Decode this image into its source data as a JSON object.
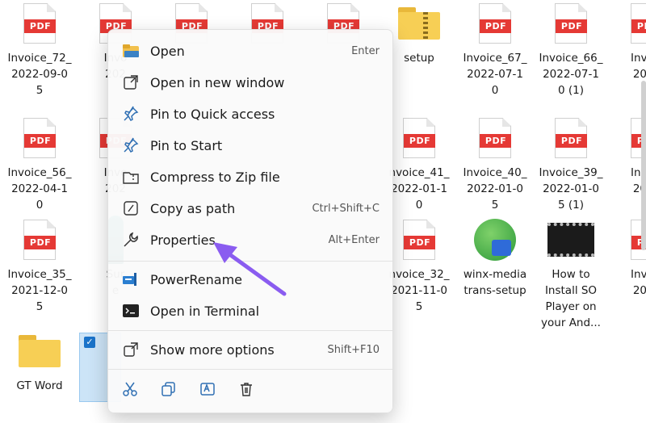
{
  "files": [
    {
      "name": "Invoice_72_\n2022-09-0\n5",
      "type": "pdf"
    },
    {
      "name": "Invo\n202",
      "type": "pdf"
    },
    {
      "name": "",
      "type": "pdf"
    },
    {
      "name": "",
      "type": "pdf"
    },
    {
      "name": "",
      "type": "pdf"
    },
    {
      "name": "setup",
      "type": "zip"
    },
    {
      "name": "Invoice_67_\n2022-07-1\n0",
      "type": "pdf"
    },
    {
      "name": "Invoice_66_\n2022-07-1\n0 (1)",
      "type": "pdf"
    },
    {
      "name": "Invoic\n2022",
      "type": "pdf"
    },
    {
      "name": "Invoice_56_\n2022-04-1\n0",
      "type": "pdf"
    },
    {
      "name": "Invo\n202",
      "type": "pdf"
    },
    {
      "name": "nvoice_41_\n2022-01-1\n0",
      "type": "pdf"
    },
    {
      "name": "Invoice_40_\n2022-01-0\n5",
      "type": "pdf"
    },
    {
      "name": "Invoice_39_\n2022-01-0\n5 (1)",
      "type": "pdf"
    },
    {
      "name": "Invoic\n2022",
      "type": "pdf"
    },
    {
      "name": "Invoice_35_\n2021-12-0\n5",
      "type": "pdf"
    },
    {
      "name": "Sur\ne",
      "type": "app-teal"
    },
    {
      "name": "nvoice_32_\n2021-11-0\n5",
      "type": "pdf"
    },
    {
      "name": "winx-media\ntrans-setup",
      "type": "app"
    },
    {
      "name": "How to\nInstall SO\nPlayer on\nyour And...",
      "type": "video"
    },
    {
      "name": "Invoic\n2021",
      "type": "pdf"
    },
    {
      "name": "GT Word",
      "type": "folder"
    }
  ],
  "pdf_badge": "PDF",
  "menu": {
    "items": [
      {
        "label": "Open",
        "shortcut": "Enter",
        "icon": "folder-open-icon"
      },
      {
        "label": "Open in new window",
        "shortcut": "",
        "icon": "open-new-window-icon"
      },
      {
        "label": "Pin to Quick access",
        "shortcut": "",
        "icon": "pin-icon"
      },
      {
        "label": "Pin to Start",
        "shortcut": "",
        "icon": "pin-icon"
      },
      {
        "label": "Compress to Zip file",
        "shortcut": "",
        "icon": "zip-icon"
      },
      {
        "label": "Copy as path",
        "shortcut": "Ctrl+Shift+C",
        "icon": "copy-path-icon"
      },
      {
        "label": "Properties",
        "shortcut": "Alt+Enter",
        "icon": "wrench-icon"
      },
      {
        "label": "PowerRename",
        "shortcut": "",
        "icon": "power-rename-icon"
      },
      {
        "label": "Open in Terminal",
        "shortcut": "",
        "icon": "terminal-icon"
      },
      {
        "label": "Show more options",
        "shortcut": "Shift+F10",
        "icon": "show-more-icon"
      }
    ],
    "tools": [
      "cut-icon",
      "copy-icon",
      "rename-icon",
      "delete-icon"
    ]
  },
  "colors": {
    "pdf_red": "#e53935",
    "accent": "#1a73c9",
    "arrow": "#8a5cf0",
    "folder": "#f7cf55"
  }
}
